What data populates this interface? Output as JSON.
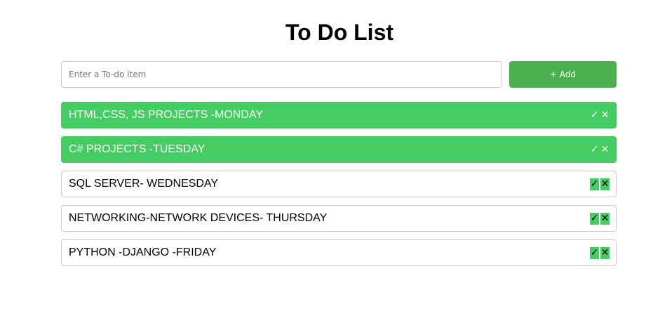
{
  "header": {
    "title": "To Do List"
  },
  "form": {
    "input_value": "",
    "placeholder": "Enter a To-do item",
    "add_label": "+ Add"
  },
  "items": [
    {
      "text": "HTML,CSS, JS PROJECTS -MONDAY",
      "completed": true
    },
    {
      "text": "C# PROJECTS -TUESDAY",
      "completed": true
    },
    {
      "text": "SQL SERVER- WEDNESDAY",
      "completed": false
    },
    {
      "text": "NETWORKING-NETWORK DEVICES- THURSDAY",
      "completed": false
    },
    {
      "text": "PYTHON -DJANGO -FRIDAY",
      "completed": false
    }
  ],
  "icons": {
    "check": "checkmark-icon",
    "delete": "close-icon"
  },
  "colors": {
    "completed_bg": "#45cc62",
    "add_button_bg": "#4caf50",
    "border": "#c9c9c9"
  }
}
